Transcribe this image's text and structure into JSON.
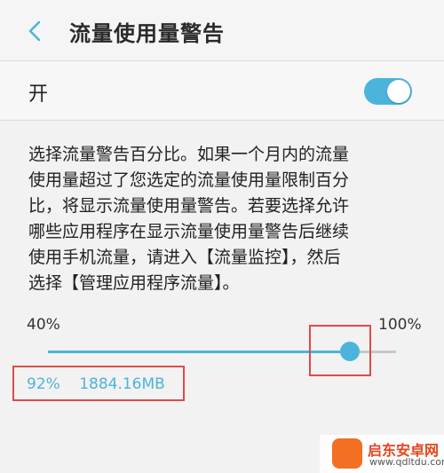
{
  "header": {
    "back_icon": "chevron-left-icon",
    "title": "流量使用量警告"
  },
  "toggle": {
    "label": "开",
    "state": "on",
    "accent_color": "#4cb4dc"
  },
  "description": {
    "lines": [
      "选择流量警告百分比。如果一个月内的流量",
      "使用量超过了您选定的流量使用量限制百分",
      "比，将显示流量使用量警告。若要选择允许",
      "哪些应用程序在显示流量使用量警告后继续",
      "使用手机流量，请进入【流量监控】，然后",
      "选择【管理应用程序流量】。"
    ]
  },
  "slider": {
    "min_label": "40%",
    "max_label": "100%",
    "min": 40,
    "max": 100,
    "value": 92
  },
  "selection": {
    "percent": "92%",
    "size": "1884.16MB"
  },
  "highlight_color": "#e04a4a",
  "watermark": {
    "name": "启东安卓网",
    "url": "www.qdltdu.com"
  }
}
